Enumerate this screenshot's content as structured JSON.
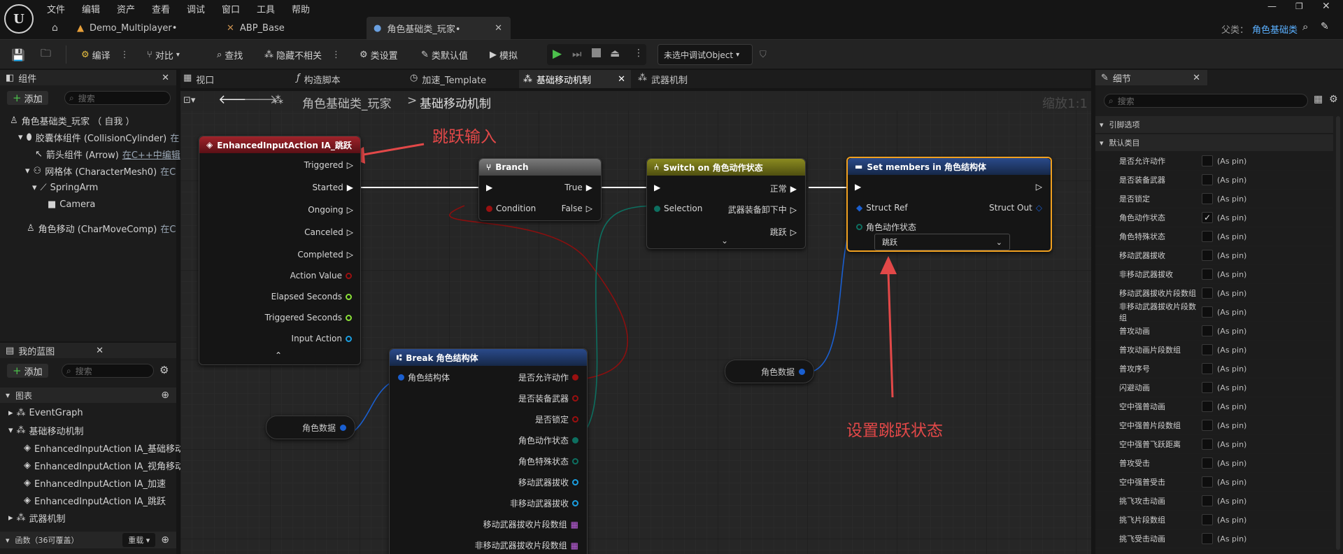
{
  "menu": [
    "文件",
    "编辑",
    "资产",
    "查看",
    "调试",
    "窗口",
    "工具",
    "帮助"
  ],
  "doc_tabs": [
    "Demo_Multiplayer•",
    "ABP_Base",
    "角色基础类_玩家•"
  ],
  "parent_label": "父类：",
  "parent_value": "角色基础类",
  "toolbar": {
    "compile": "编译",
    "diff": "对比",
    "find": "查找",
    "hide_unrelated": "隐藏不相关",
    "class_settings": "类设置",
    "class_defaults": "类默认值",
    "simulate": "模拟",
    "debug_object": "未选中调试Object"
  },
  "components": {
    "title": "组件",
    "add": "添加",
    "search_placeholder": "搜索",
    "tree": [
      {
        "label": "角色基础类_玩家 （ 自我 ）",
        "extra": ""
      },
      {
        "label": "胶囊体组件 (CollisionCylinder)",
        "extra": "在"
      },
      {
        "label": "箭头组件 (Arrow)",
        "extra": "在C++中编辑"
      },
      {
        "label": "网格体 (CharacterMesh0)",
        "extra": "在C"
      },
      {
        "label": "SpringArm",
        "extra": ""
      },
      {
        "label": "Camera",
        "extra": ""
      },
      {
        "label": "角色移动 (CharMoveComp)",
        "extra": "在C"
      }
    ]
  },
  "mybp": {
    "title": "我的蓝图",
    "add": "添加",
    "search_placeholder": "搜索",
    "graphs_label": "图表",
    "items": [
      "EventGraph",
      "基础移动机制",
      "EnhancedInputAction IA_基础移动",
      "EnhancedInputAction IA_视角移动",
      "EnhancedInputAction IA_加速",
      "EnhancedInputAction IA_跳跃",
      "武器机制"
    ],
    "functions_label": "函数（36可覆盖）",
    "override": "重载"
  },
  "graph_tabs": [
    "视口",
    "构造脚本",
    "加速_Template",
    "基础移动机制",
    "武器机制"
  ],
  "breadcrumb": {
    "root": "角色基础类_玩家",
    "sep": ">",
    "current": "基础移动机制",
    "zoom": "缩放1:1"
  },
  "annotations": {
    "jump_input": "跳跃输入",
    "set_jump_state": "设置跳跃状态"
  },
  "nodes": {
    "input": {
      "title": "EnhancedInputAction IA_跳跃",
      "pins": [
        "Triggered",
        "Started",
        "Ongoing",
        "Canceled",
        "Completed",
        "Action Value",
        "Elapsed Seconds",
        "Triggered Seconds",
        "Input Action"
      ]
    },
    "branch": {
      "title": "Branch",
      "true": "True",
      "false": "False",
      "condition": "Condition"
    },
    "switch": {
      "title": "Switch on 角色动作状态",
      "selection": "Selection",
      "outs": [
        "正常",
        "武器装备卸下中",
        "跳跃"
      ]
    },
    "set": {
      "title": "Set members in 角色结构体",
      "struct_ref": "Struct Ref",
      "struct_out": "Struct Out",
      "field": "角色动作状态",
      "value": "跳跃"
    },
    "break": {
      "title": "Break 角色结构体",
      "input": "角色结构体",
      "outs": [
        "是否允许动作",
        "是否装备武器",
        "是否锁定",
        "角色动作状态",
        "角色特殊状态",
        "移动武器拔收",
        "非移动武器拔收",
        "移动武器拔收片段数组",
        "非移动武器拔收片段数组"
      ]
    },
    "var1": "角色数据",
    "var2": "角色数据"
  },
  "details": {
    "title": "细节",
    "search_placeholder": "搜索",
    "section1": "引脚选项",
    "section2": "默认类目",
    "as_pin": "(As pin)",
    "rows": [
      {
        "label": "是否允许动作",
        "checked": false
      },
      {
        "label": "是否装备武器",
        "checked": false
      },
      {
        "label": "是否锁定",
        "checked": false
      },
      {
        "label": "角色动作状态",
        "checked": true
      },
      {
        "label": "角色特殊状态",
        "checked": false
      },
      {
        "label": "移动武器拔收",
        "checked": false
      },
      {
        "label": "非移动武器拔收",
        "checked": false
      },
      {
        "label": "移动武器拔收片段数组",
        "checked": false
      },
      {
        "label": "非移动武器拔收片段数组",
        "checked": false
      },
      {
        "label": "普攻动画",
        "checked": false
      },
      {
        "label": "普攻动画片段数组",
        "checked": false
      },
      {
        "label": "普攻序号",
        "checked": false
      },
      {
        "label": "闪避动画",
        "checked": false
      },
      {
        "label": "空中强普动画",
        "checked": false
      },
      {
        "label": "空中强普片段数组",
        "checked": false
      },
      {
        "label": "空中强普飞跃距离",
        "checked": false
      },
      {
        "label": "普攻受击",
        "checked": false
      },
      {
        "label": "空中强普受击",
        "checked": false
      },
      {
        "label": "挑飞攻击动画",
        "checked": false
      },
      {
        "label": "挑飞片段数组",
        "checked": false
      },
      {
        "label": "挑飞受击动画",
        "checked": false
      }
    ]
  }
}
